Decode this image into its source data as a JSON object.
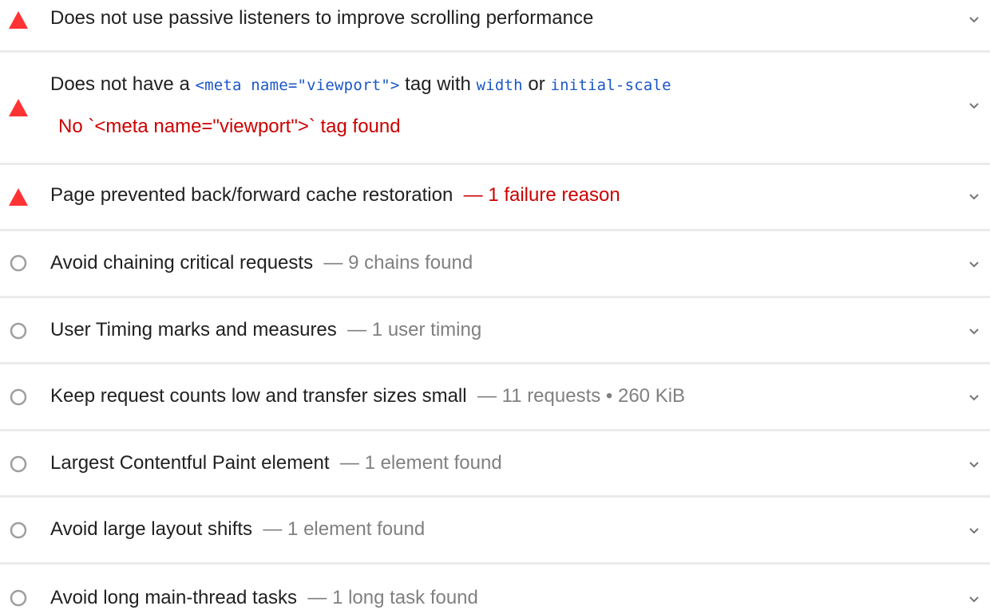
{
  "colors": {
    "fail": "#f33",
    "fail_text": "#cc0000",
    "info_icon": "#9e9e9e",
    "info_text": "#808080",
    "code": "#1a56c7",
    "title": "#212121",
    "divider": "#ebebeb"
  },
  "audits": [
    {
      "status": "fail",
      "icon": "warning-triangle-icon",
      "title": "Does not use passive listeners to improve scrolling performance",
      "separator": "",
      "display_value": ""
    },
    {
      "status": "fail",
      "icon": "warning-triangle-icon",
      "title_parts": {
        "t1": "Does not have a ",
        "c1": "<meta name=\"viewport\">",
        "t2": " tag with ",
        "c2": "width",
        "t3": " or ",
        "c3": "initial-scale"
      },
      "explanation": "No `<meta name=\"viewport\">` tag found"
    },
    {
      "status": "fail",
      "icon": "warning-triangle-icon",
      "title": "Page prevented back/forward cache restoration",
      "separator": "—",
      "display_value": "1 failure reason"
    },
    {
      "status": "info",
      "icon": "circle-outline-icon",
      "title": "Avoid chaining critical requests",
      "separator": "—",
      "display_value": "9 chains found"
    },
    {
      "status": "info",
      "icon": "circle-outline-icon",
      "title": "User Timing marks and measures",
      "separator": "—",
      "display_value": "1 user timing"
    },
    {
      "status": "info",
      "icon": "circle-outline-icon",
      "title": "Keep request counts low and transfer sizes small",
      "separator": "—",
      "display_value": "11 requests • 260 KiB"
    },
    {
      "status": "info",
      "icon": "circle-outline-icon",
      "title": "Largest Contentful Paint element",
      "separator": "—",
      "display_value": "1 element found"
    },
    {
      "status": "info",
      "icon": "circle-outline-icon",
      "title": "Avoid large layout shifts",
      "separator": "—",
      "display_value": "1 element found"
    },
    {
      "status": "info",
      "icon": "circle-outline-icon",
      "title": "Avoid long main-thread tasks",
      "separator": "—",
      "display_value": "1 long task found"
    }
  ]
}
